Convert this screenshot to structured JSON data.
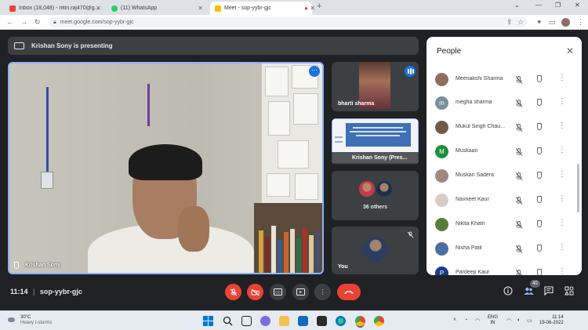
{
  "browser": {
    "tabs": [
      {
        "label": "Inbox (18,048) - nitin.raj470@g...",
        "favicon_color": "#ea4335",
        "active": false
      },
      {
        "label": "(11) WhatsApp",
        "favicon_color": "#25d366",
        "active": false
      },
      {
        "label": "Meet - sop-yybr-gjc",
        "favicon_color": "#fbbc04",
        "active": true
      }
    ],
    "url": "meet.google.com/sop-yybr-gjc"
  },
  "meet": {
    "presenting_banner": "Krishan Sony is presenting",
    "main_tile_name": "Krishan Sony",
    "side_tiles": {
      "bharti": "bharti sharma",
      "presentation": "Krishan Sony (Pres...",
      "others": "36 others",
      "you": "You"
    },
    "meeting_time": "11:14",
    "meeting_code": "sop-yybr-gjc",
    "participant_count": "40"
  },
  "people_panel": {
    "title": "People",
    "participants": [
      {
        "name": "Meenakshi Sharma",
        "avatar_letter": "",
        "avatar_color": "#8d6e63"
      },
      {
        "name": "megha sharma",
        "avatar_letter": "m",
        "avatar_color": "#78909c"
      },
      {
        "name": "Mukul Singh Chau...",
        "avatar_letter": "",
        "avatar_color": "#6d5c4c"
      },
      {
        "name": "Muskaan",
        "avatar_letter": "M",
        "avatar_color": "#1e8e3e"
      },
      {
        "name": "Muskan Sadera",
        "avatar_letter": "",
        "avatar_color": "#a1887f"
      },
      {
        "name": "Navneet Kaur",
        "avatar_letter": "",
        "avatar_color": "#d7ccc8"
      },
      {
        "name": "Nikita Khatri",
        "avatar_letter": "",
        "avatar_color": "#5d7c3b"
      },
      {
        "name": "Nisha Patil",
        "avatar_letter": "",
        "avatar_color": "#4a6fa5"
      },
      {
        "name": "Pardeep Kaur",
        "avatar_letter": "P",
        "avatar_color": "#1a3a8a"
      }
    ]
  },
  "taskbar": {
    "weather_temp": "30°C",
    "weather_desc": "Heavy t-storms",
    "lang_line1": "ENG",
    "lang_line2": "IN",
    "time": "11:14",
    "date": "19-06-2022"
  },
  "colors": {
    "meet_bg": "#202124",
    "accent": "#8ab4f8",
    "danger": "#ea4335",
    "panel_bg": "#ffffff"
  }
}
